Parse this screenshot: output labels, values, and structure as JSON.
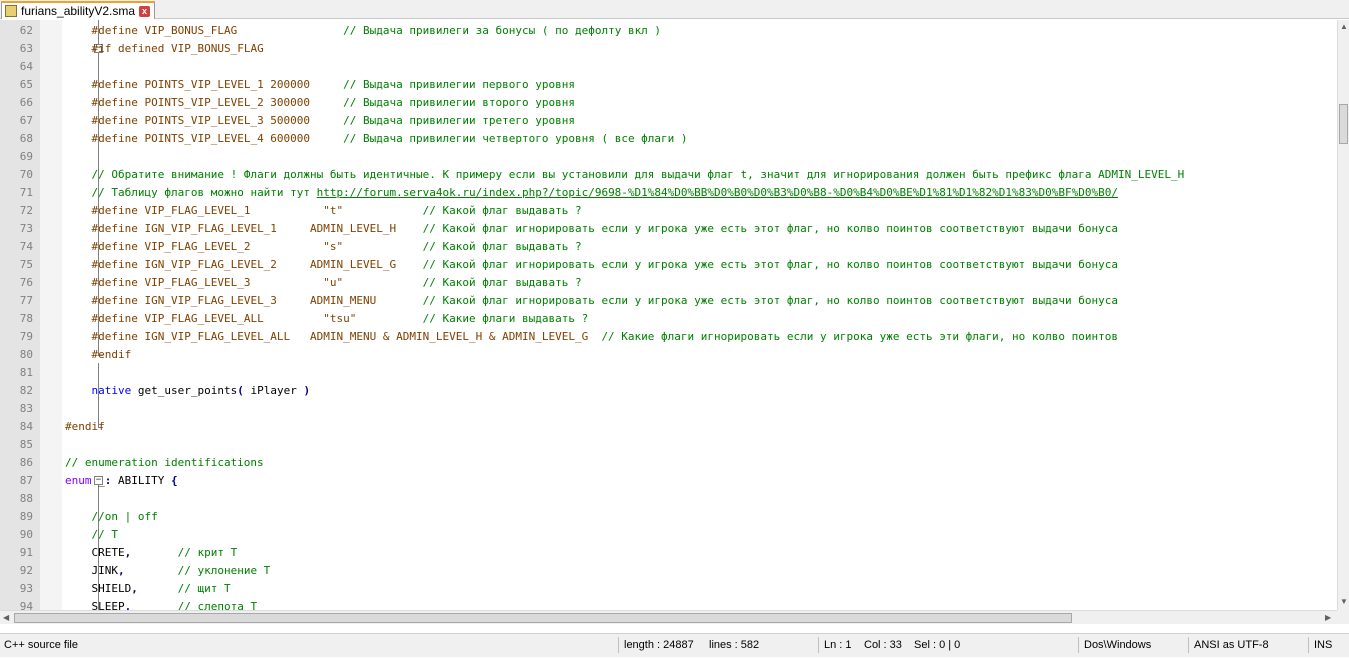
{
  "tab": {
    "title": "furians_abilityV2.sma",
    "close_glyph": "x"
  },
  "editor": {
    "lines": [
      {
        "n": "62",
        "tokens": [
          [
            "    ",
            ""
          ],
          [
            "#define VIP_BONUS_FLAG                ",
            "pp"
          ],
          [
            "// Выдача привилеги за бонусы ( по дефолту вкл )",
            "cm"
          ]
        ]
      },
      {
        "n": "63",
        "tokens": [
          [
            "    ",
            ""
          ],
          [
            "#if defined VIP_BONUS_FLAG",
            "pp"
          ]
        ]
      },
      {
        "n": "64",
        "tokens": []
      },
      {
        "n": "65",
        "tokens": [
          [
            "    ",
            ""
          ],
          [
            "#define POINTS_VIP_LEVEL_1 200000     ",
            "pp"
          ],
          [
            "// Выдача привилегии первого уровня",
            "cm"
          ]
        ]
      },
      {
        "n": "66",
        "tokens": [
          [
            "    ",
            ""
          ],
          [
            "#define POINTS_VIP_LEVEL_2 300000     ",
            "pp"
          ],
          [
            "// Выдача привилегии второго уровня",
            "cm"
          ]
        ]
      },
      {
        "n": "67",
        "tokens": [
          [
            "    ",
            ""
          ],
          [
            "#define POINTS_VIP_LEVEL_3 500000     ",
            "pp"
          ],
          [
            "// Выдача привилегии третего уровня",
            "cm"
          ]
        ]
      },
      {
        "n": "68",
        "tokens": [
          [
            "    ",
            ""
          ],
          [
            "#define POINTS_VIP_LEVEL_4 600000     ",
            "pp"
          ],
          [
            "// Выдача привилегии четвертого уровня ( все флаги )",
            "cm"
          ]
        ]
      },
      {
        "n": "69",
        "tokens": []
      },
      {
        "n": "70",
        "tokens": [
          [
            "    ",
            ""
          ],
          [
            "// Обратите внимание ! Флаги должны быть идентичные. К примеру если вы установили для выдачи флаг t, значит для игнорирования должен быть префикс флага ADMIN_LEVEL_H",
            "cm"
          ]
        ]
      },
      {
        "n": "71",
        "tokens": [
          [
            "    ",
            ""
          ],
          [
            "// Таблицу флагов можно найти тут ",
            "cm"
          ],
          [
            "http://forum.serva4ok.ru/index.php?/topic/9698-%D1%84%D0%BB%D0%B0%D0%B3%D0%B8-%D0%B4%D0%BE%D1%81%D1%82%D1%83%D0%BF%D0%B0/",
            "link"
          ]
        ]
      },
      {
        "n": "72",
        "tokens": [
          [
            "    ",
            ""
          ],
          [
            "#define VIP_FLAG_LEVEL_1           \"t\"            ",
            "pp"
          ],
          [
            "// Какой флаг выдавать ?",
            "cm"
          ]
        ]
      },
      {
        "n": "73",
        "tokens": [
          [
            "    ",
            ""
          ],
          [
            "#define IGN_VIP_FLAG_LEVEL_1     ADMIN_LEVEL_H    ",
            "pp"
          ],
          [
            "// Какой флаг игнорировать если у игрока уже есть этот флаг, но колво поинтов соответствуют выдачи бонуса",
            "cm"
          ]
        ]
      },
      {
        "n": "74",
        "tokens": [
          [
            "    ",
            ""
          ],
          [
            "#define VIP_FLAG_LEVEL_2           \"s\"            ",
            "pp"
          ],
          [
            "// Какой флаг выдавать ?",
            "cm"
          ]
        ]
      },
      {
        "n": "75",
        "tokens": [
          [
            "    ",
            ""
          ],
          [
            "#define IGN_VIP_FLAG_LEVEL_2     ADMIN_LEVEL_G    ",
            "pp"
          ],
          [
            "// Какой флаг игнорировать если у игрока уже есть этот флаг, но колво поинтов соответствуют выдачи бонуса",
            "cm"
          ]
        ]
      },
      {
        "n": "76",
        "tokens": [
          [
            "    ",
            ""
          ],
          [
            "#define VIP_FLAG_LEVEL_3           \"u\"            ",
            "pp"
          ],
          [
            "// Какой флаг выдавать ?",
            "cm"
          ]
        ]
      },
      {
        "n": "77",
        "tokens": [
          [
            "    ",
            ""
          ],
          [
            "#define IGN_VIP_FLAG_LEVEL_3     ADMIN_MENU       ",
            "pp"
          ],
          [
            "// Какой флаг игнорировать если у игрока уже есть этот флаг, но колво поинтов соответствуют выдачи бонуса",
            "cm"
          ]
        ]
      },
      {
        "n": "78",
        "tokens": [
          [
            "    ",
            ""
          ],
          [
            "#define VIP_FLAG_LEVEL_ALL         \"tsu\"          ",
            "pp"
          ],
          [
            "// Какие флаги выдавать ?",
            "cm"
          ]
        ]
      },
      {
        "n": "79",
        "tokens": [
          [
            "    ",
            ""
          ],
          [
            "#define IGN_VIP_FLAG_LEVEL_ALL   ADMIN_MENU & ADMIN_LEVEL_H & ADMIN_LEVEL_G  ",
            "pp"
          ],
          [
            "// Какие флаги игнорировать если у игрока уже есть эти флаги, но колво поинтов",
            "cm"
          ]
        ]
      },
      {
        "n": "80",
        "tokens": [
          [
            "    ",
            ""
          ],
          [
            "#endif",
            "pp"
          ]
        ]
      },
      {
        "n": "81",
        "tokens": []
      },
      {
        "n": "82",
        "tokens": [
          [
            "    ",
            ""
          ],
          [
            "native",
            "kw"
          ],
          [
            " get_user_points",
            ""
          ],
          [
            "(",
            "op"
          ],
          [
            " iPlayer ",
            ""
          ],
          [
            ")",
            "op"
          ]
        ]
      },
      {
        "n": "83",
        "tokens": []
      },
      {
        "n": "84",
        "tokens": [
          [
            "#endif",
            "pp"
          ]
        ]
      },
      {
        "n": "85",
        "tokens": []
      },
      {
        "n": "86",
        "tokens": [
          [
            "// enumeration identifications",
            "cm"
          ]
        ]
      },
      {
        "n": "87",
        "tokens": [
          [
            "enum",
            "type"
          ],
          [
            " _",
            ""
          ],
          [
            ":",
            "op"
          ],
          [
            " ABILITY ",
            ""
          ],
          [
            "{",
            "op"
          ]
        ]
      },
      {
        "n": "88",
        "tokens": []
      },
      {
        "n": "89",
        "tokens": [
          [
            "    ",
            ""
          ],
          [
            "//on | off",
            "cm"
          ]
        ]
      },
      {
        "n": "90",
        "tokens": [
          [
            "    ",
            ""
          ],
          [
            "// T",
            "cm"
          ]
        ]
      },
      {
        "n": "91",
        "tokens": [
          [
            "    CRETE",
            ""
          ],
          [
            ",",
            "op"
          ],
          [
            "       ",
            ""
          ],
          [
            "// крит T",
            "cm"
          ]
        ]
      },
      {
        "n": "92",
        "tokens": [
          [
            "    JINK",
            ""
          ],
          [
            ",",
            "op"
          ],
          [
            "        ",
            ""
          ],
          [
            "// уклонение T",
            "cm"
          ]
        ]
      },
      {
        "n": "93",
        "tokens": [
          [
            "    SHIELD",
            ""
          ],
          [
            ",",
            "op"
          ],
          [
            "      ",
            ""
          ],
          [
            "// щит T",
            "cm"
          ]
        ]
      },
      {
        "n": "94",
        "tokens": [
          [
            "    SLEEP",
            ""
          ],
          [
            ",",
            "op"
          ],
          [
            "       ",
            ""
          ],
          [
            "// слепота T",
            "cm"
          ]
        ]
      }
    ]
  },
  "statusbar": {
    "language": "C++ source file",
    "length": "length : 24887",
    "lines": "lines : 582",
    "ln": "Ln : 1",
    "col": "Col : 33",
    "sel": "Sel : 0 | 0",
    "eol": "Dos\\Windows",
    "encoding": "ANSI as UTF-8",
    "mode": "INS"
  },
  "icons": {
    "file": "file-icon",
    "close": "close-icon"
  },
  "colors": {
    "keyword": "#0000ff",
    "preprocessor": "#804000",
    "comment": "#008000",
    "type": "#8000ff",
    "operator": "#000080"
  }
}
